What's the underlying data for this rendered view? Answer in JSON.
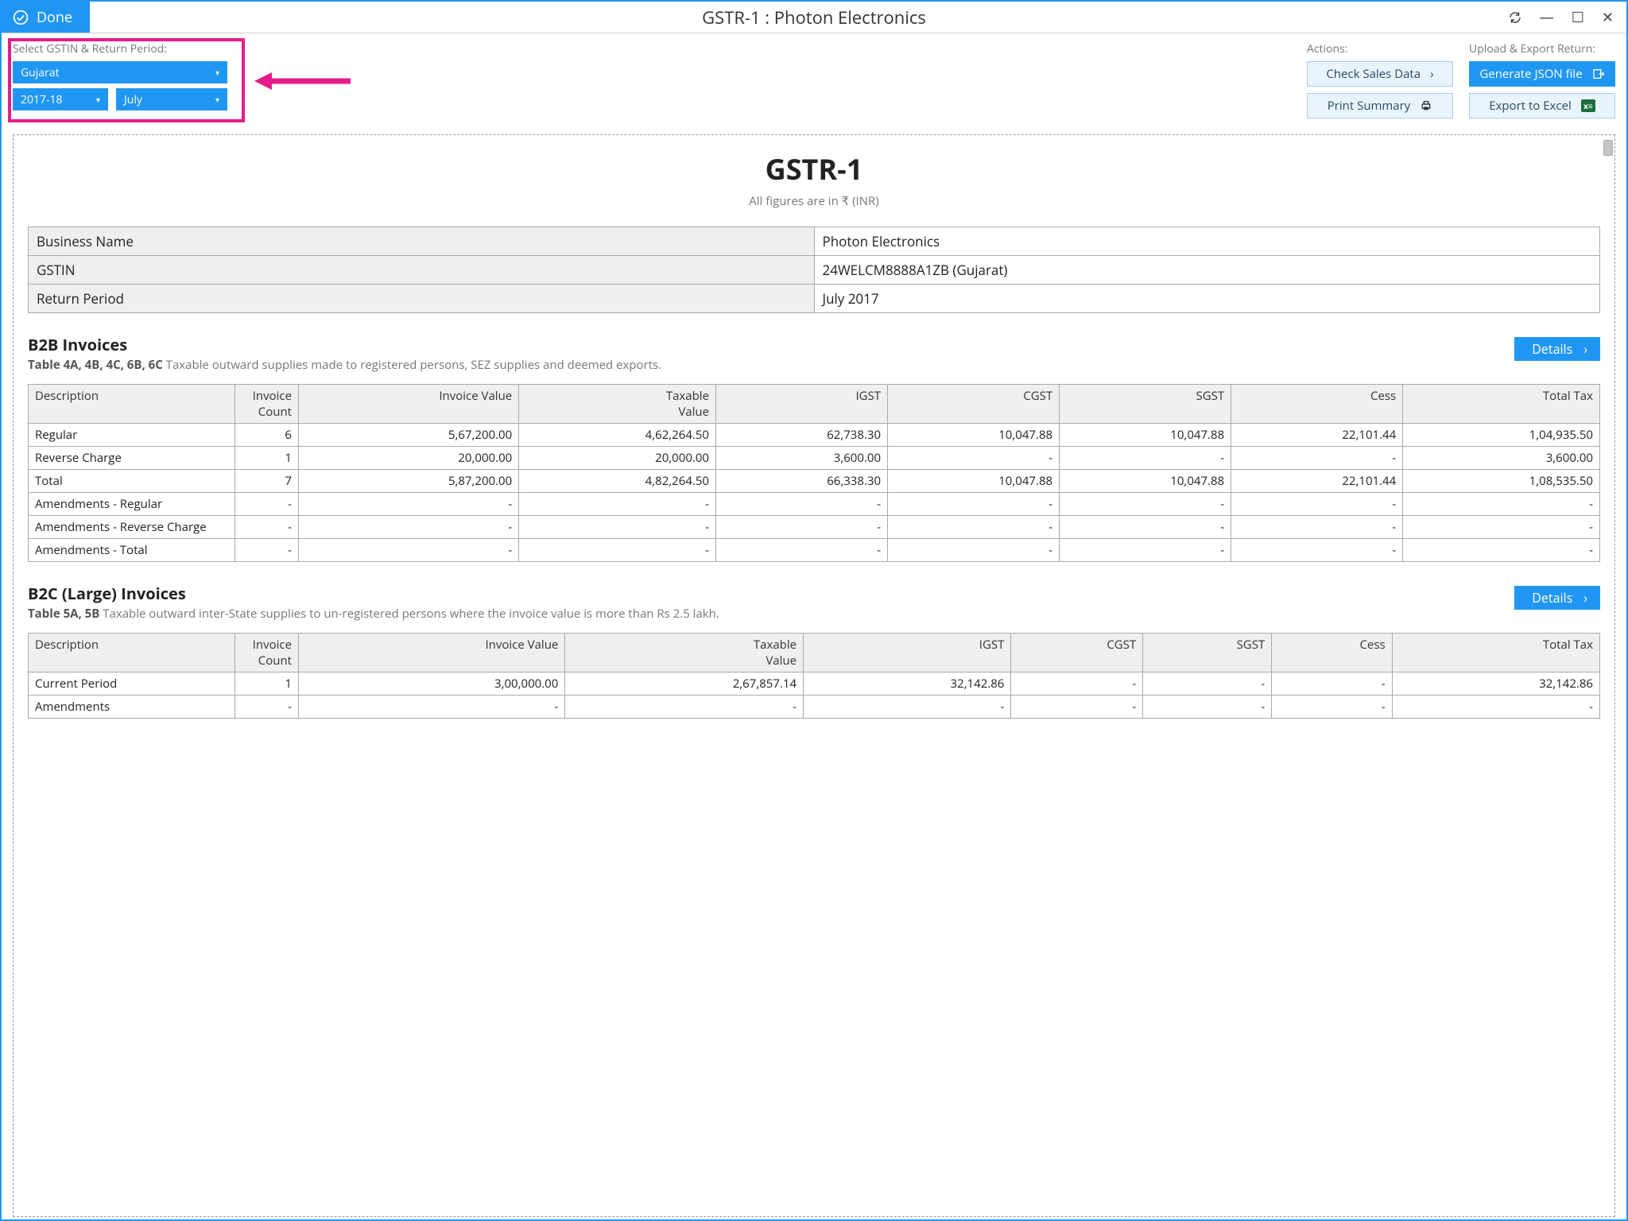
{
  "window": {
    "title": "GSTR-1 : Photon Electronics",
    "done_label": "Done"
  },
  "filters": {
    "label": "Select GSTIN & Return Period:",
    "state": "Gujarat",
    "year": "2017-18",
    "month": "July"
  },
  "actions": {
    "label": "Actions:",
    "check_sales": "Check Sales Data",
    "print_summary": "Print Summary"
  },
  "export": {
    "label": "Upload & Export Return:",
    "generate_json": "Generate JSON file",
    "export_excel": "Export to Excel"
  },
  "report": {
    "title": "GSTR-1",
    "subtitle": "All figures are in ₹ (INR)",
    "info": {
      "business_name_label": "Business Name",
      "business_name": "Photon Electronics",
      "gstin_label": "GSTIN",
      "gstin": "24WELCM8888A1ZB (Gujarat)",
      "period_label": "Return Period",
      "period": "July 2017"
    },
    "details_label": "Details",
    "b2b": {
      "title": "B2B Invoices",
      "sub_bold": "Table 4A, 4B, 4C, 6B, 6C",
      "sub_rest": " Taxable outward supplies made to registered persons, SEZ supplies and deemed exports.",
      "headers": [
        "Description",
        "Invoice Count",
        "Invoice Value",
        "Taxable Value",
        "IGST",
        "CGST",
        "SGST",
        "Cess",
        "Total Tax"
      ],
      "rows": [
        [
          "Regular",
          "6",
          "5,67,200.00",
          "4,62,264.50",
          "62,738.30",
          "10,047.88",
          "10,047.88",
          "22,101.44",
          "1,04,935.50"
        ],
        [
          "Reverse Charge",
          "1",
          "20,000.00",
          "20,000.00",
          "3,600.00",
          "-",
          "-",
          "-",
          "3,600.00"
        ],
        [
          "Total",
          "7",
          "5,87,200.00",
          "4,82,264.50",
          "66,338.30",
          "10,047.88",
          "10,047.88",
          "22,101.44",
          "1,08,535.50"
        ],
        [
          "Amendments - Regular",
          "-",
          "-",
          "-",
          "-",
          "-",
          "-",
          "-",
          "-"
        ],
        [
          "Amendments - Reverse Charge",
          "-",
          "-",
          "-",
          "-",
          "-",
          "-",
          "-",
          "-"
        ],
        [
          "Amendments - Total",
          "-",
          "-",
          "-",
          "-",
          "-",
          "-",
          "-",
          "-"
        ]
      ]
    },
    "b2cl": {
      "title": "B2C (Large) Invoices",
      "sub_bold": "Table 5A, 5B",
      "sub_rest": " Taxable outward inter-State supplies to un-registered persons where the invoice value is more than Rs 2.5 lakh.",
      "headers": [
        "Description",
        "Invoice Count",
        "Invoice Value",
        "Taxable Value",
        "IGST",
        "CGST",
        "SGST",
        "Cess",
        "Total Tax"
      ],
      "rows": [
        [
          "Current Period",
          "1",
          "3,00,000.00",
          "2,67,857.14",
          "32,142.86",
          "-",
          "-",
          "-",
          "32,142.86"
        ],
        [
          "Amendments",
          "-",
          "-",
          "-",
          "-",
          "-",
          "-",
          "-",
          "-"
        ]
      ]
    }
  }
}
